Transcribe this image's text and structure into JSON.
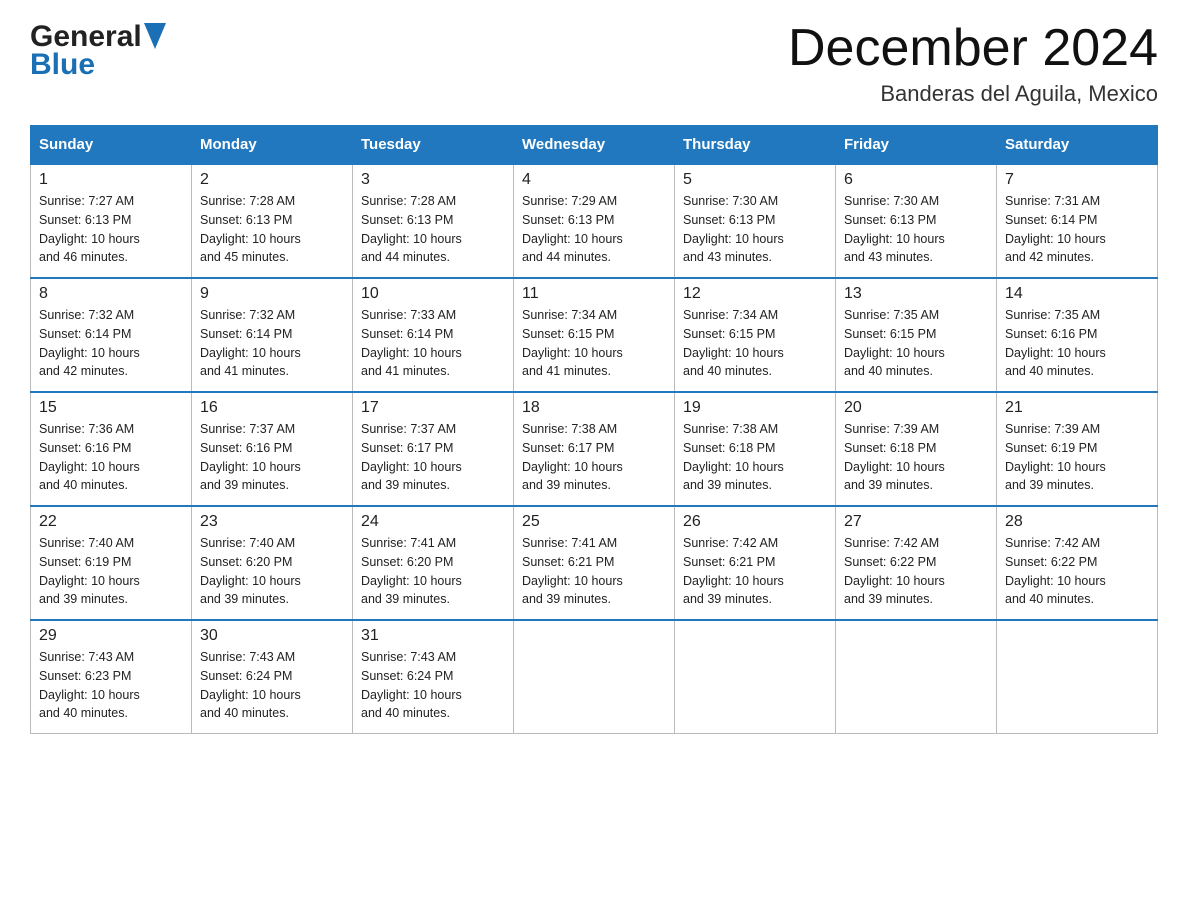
{
  "header": {
    "logo_general": "General",
    "logo_blue": "Blue",
    "title": "December 2024",
    "subtitle": "Banderas del Aguila, Mexico"
  },
  "days_of_week": [
    "Sunday",
    "Monday",
    "Tuesday",
    "Wednesday",
    "Thursday",
    "Friday",
    "Saturday"
  ],
  "weeks": [
    [
      {
        "day": 1,
        "sunrise": "7:27 AM",
        "sunset": "6:13 PM",
        "daylight": "10 hours and 46 minutes."
      },
      {
        "day": 2,
        "sunrise": "7:28 AM",
        "sunset": "6:13 PM",
        "daylight": "10 hours and 45 minutes."
      },
      {
        "day": 3,
        "sunrise": "7:28 AM",
        "sunset": "6:13 PM",
        "daylight": "10 hours and 44 minutes."
      },
      {
        "day": 4,
        "sunrise": "7:29 AM",
        "sunset": "6:13 PM",
        "daylight": "10 hours and 44 minutes."
      },
      {
        "day": 5,
        "sunrise": "7:30 AM",
        "sunset": "6:13 PM",
        "daylight": "10 hours and 43 minutes."
      },
      {
        "day": 6,
        "sunrise": "7:30 AM",
        "sunset": "6:13 PM",
        "daylight": "10 hours and 43 minutes."
      },
      {
        "day": 7,
        "sunrise": "7:31 AM",
        "sunset": "6:14 PM",
        "daylight": "10 hours and 42 minutes."
      }
    ],
    [
      {
        "day": 8,
        "sunrise": "7:32 AM",
        "sunset": "6:14 PM",
        "daylight": "10 hours and 42 minutes."
      },
      {
        "day": 9,
        "sunrise": "7:32 AM",
        "sunset": "6:14 PM",
        "daylight": "10 hours and 41 minutes."
      },
      {
        "day": 10,
        "sunrise": "7:33 AM",
        "sunset": "6:14 PM",
        "daylight": "10 hours and 41 minutes."
      },
      {
        "day": 11,
        "sunrise": "7:34 AM",
        "sunset": "6:15 PM",
        "daylight": "10 hours and 41 minutes."
      },
      {
        "day": 12,
        "sunrise": "7:34 AM",
        "sunset": "6:15 PM",
        "daylight": "10 hours and 40 minutes."
      },
      {
        "day": 13,
        "sunrise": "7:35 AM",
        "sunset": "6:15 PM",
        "daylight": "10 hours and 40 minutes."
      },
      {
        "day": 14,
        "sunrise": "7:35 AM",
        "sunset": "6:16 PM",
        "daylight": "10 hours and 40 minutes."
      }
    ],
    [
      {
        "day": 15,
        "sunrise": "7:36 AM",
        "sunset": "6:16 PM",
        "daylight": "10 hours and 40 minutes."
      },
      {
        "day": 16,
        "sunrise": "7:37 AM",
        "sunset": "6:16 PM",
        "daylight": "10 hours and 39 minutes."
      },
      {
        "day": 17,
        "sunrise": "7:37 AM",
        "sunset": "6:17 PM",
        "daylight": "10 hours and 39 minutes."
      },
      {
        "day": 18,
        "sunrise": "7:38 AM",
        "sunset": "6:17 PM",
        "daylight": "10 hours and 39 minutes."
      },
      {
        "day": 19,
        "sunrise": "7:38 AM",
        "sunset": "6:18 PM",
        "daylight": "10 hours and 39 minutes."
      },
      {
        "day": 20,
        "sunrise": "7:39 AM",
        "sunset": "6:18 PM",
        "daylight": "10 hours and 39 minutes."
      },
      {
        "day": 21,
        "sunrise": "7:39 AM",
        "sunset": "6:19 PM",
        "daylight": "10 hours and 39 minutes."
      }
    ],
    [
      {
        "day": 22,
        "sunrise": "7:40 AM",
        "sunset": "6:19 PM",
        "daylight": "10 hours and 39 minutes."
      },
      {
        "day": 23,
        "sunrise": "7:40 AM",
        "sunset": "6:20 PM",
        "daylight": "10 hours and 39 minutes."
      },
      {
        "day": 24,
        "sunrise": "7:41 AM",
        "sunset": "6:20 PM",
        "daylight": "10 hours and 39 minutes."
      },
      {
        "day": 25,
        "sunrise": "7:41 AM",
        "sunset": "6:21 PM",
        "daylight": "10 hours and 39 minutes."
      },
      {
        "day": 26,
        "sunrise": "7:42 AM",
        "sunset": "6:21 PM",
        "daylight": "10 hours and 39 minutes."
      },
      {
        "day": 27,
        "sunrise": "7:42 AM",
        "sunset": "6:22 PM",
        "daylight": "10 hours and 39 minutes."
      },
      {
        "day": 28,
        "sunrise": "7:42 AM",
        "sunset": "6:22 PM",
        "daylight": "10 hours and 40 minutes."
      }
    ],
    [
      {
        "day": 29,
        "sunrise": "7:43 AM",
        "sunset": "6:23 PM",
        "daylight": "10 hours and 40 minutes."
      },
      {
        "day": 30,
        "sunrise": "7:43 AM",
        "sunset": "6:24 PM",
        "daylight": "10 hours and 40 minutes."
      },
      {
        "day": 31,
        "sunrise": "7:43 AM",
        "sunset": "6:24 PM",
        "daylight": "10 hours and 40 minutes."
      },
      null,
      null,
      null,
      null
    ]
  ]
}
